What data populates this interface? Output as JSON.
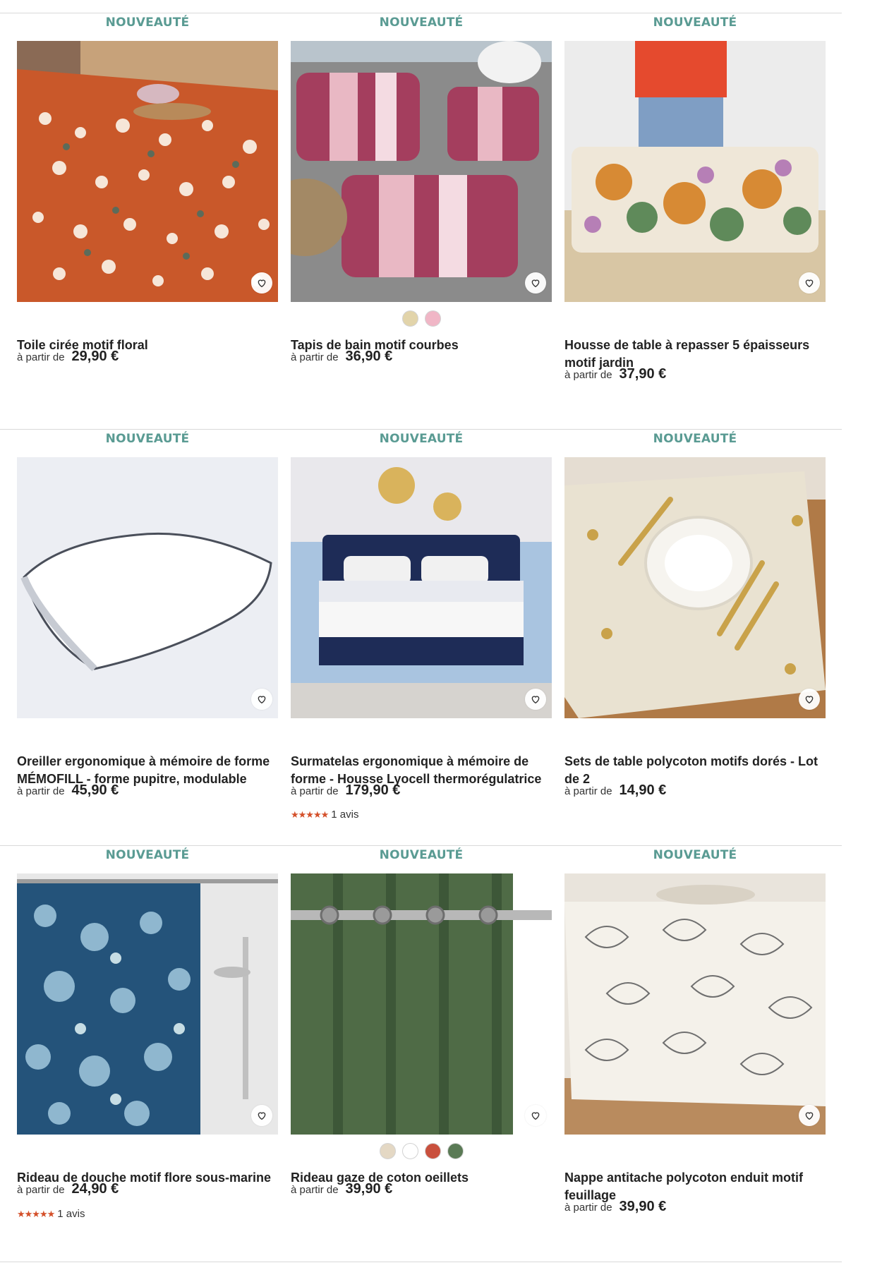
{
  "badge_label": "NOUVEAUTÉ",
  "price_prefix": "à partir de",
  "colors": {
    "badge": "#5a9b93",
    "stars": "#d4502a",
    "divider": "#d9d9d9"
  },
  "products": [
    {
      "title": "Toile cirée motif floral",
      "price": "29,90 €",
      "image": "floral-oilcloth-table-image"
    },
    {
      "title": "Tapis de bain motif courbes",
      "price": "36,90 €",
      "swatches": [
        "#e2d4aa",
        "#f0b6c6"
      ],
      "image": "pink-bath-mats-image"
    },
    {
      "title": "Housse de table à repasser 5 épaisseurs motif jardin",
      "price": "37,90 €",
      "image": "ironing-board-cover-image"
    },
    {
      "title": "Oreiller ergonomique à mémoire de forme MÉMOFILL - forme pupitre, modulable",
      "price": "45,90 €",
      "image": "white-pillow-image"
    },
    {
      "title": "Surmatelas ergonomique à mémoire de forme - Housse Lyocell thermorégulatrice",
      "price": "179,90 €",
      "rating": {
        "stars": "★★★★★",
        "reviews": "1 avis"
      },
      "image": "bed-mattress-topper-image"
    },
    {
      "title": "Sets de table polycoton motifs dorés - Lot de 2",
      "price": "14,90 €",
      "image": "table-placemats-image"
    },
    {
      "title": "Rideau de douche motif flore sous-marine",
      "price": "24,90 €",
      "rating": {
        "stars": "★★★★★",
        "reviews": "1 avis"
      },
      "image": "blue-shower-curtain-image"
    },
    {
      "title": "Rideau gaze de coton oeillets",
      "price": "39,90 €",
      "swatches": [
        "#e4d8c4",
        "#ffffff",
        "#c9503d",
        "#5a7a55"
      ],
      "image": "green-curtain-image"
    },
    {
      "title": "Nappe antitache polycoton enduit motif feuillage",
      "price": "39,90 €",
      "image": "leaf-tablecloth-image"
    }
  ]
}
